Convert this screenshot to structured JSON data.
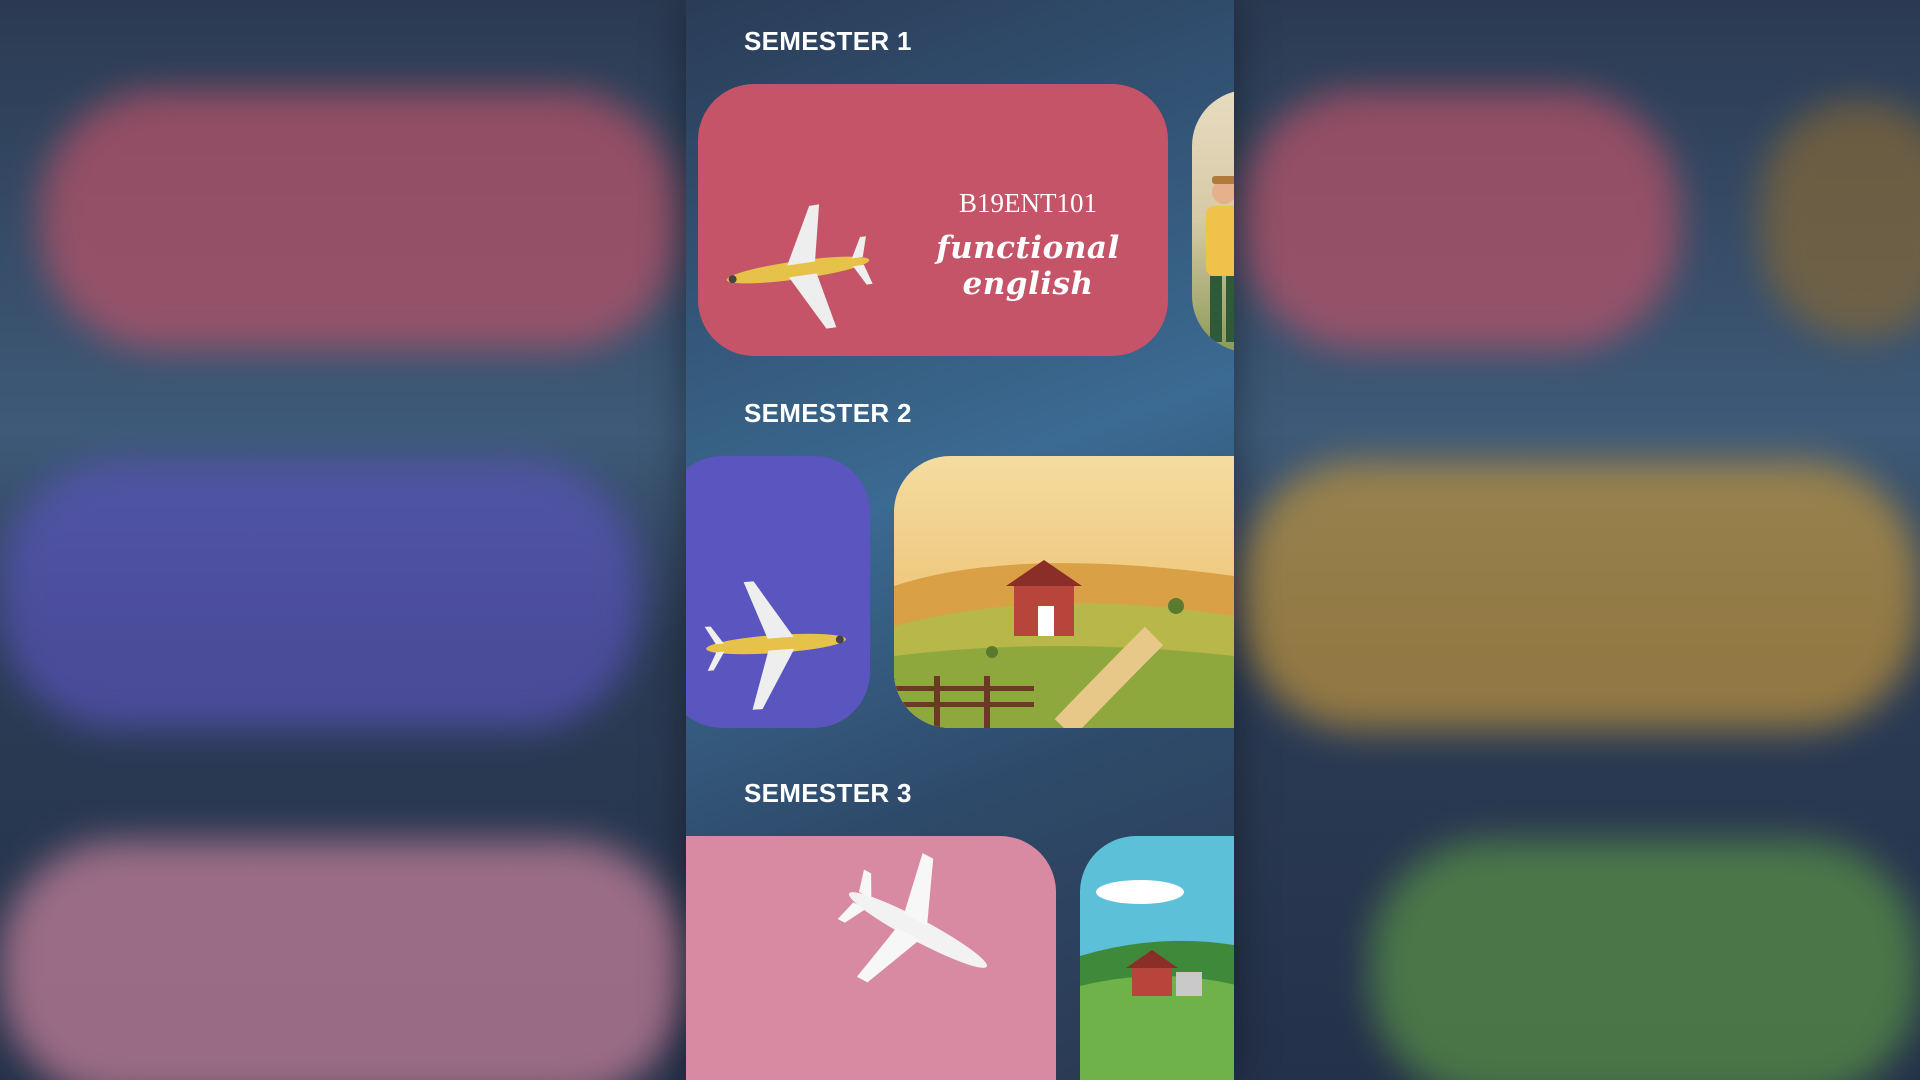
{
  "semesters": [
    {
      "title": "SEMESTER 1",
      "cards": [
        {
          "code": "B19ENT101",
          "name": "functional english",
          "color": "#c65468",
          "art": "airplane-gold"
        },
        {
          "art": "farmer-illustration"
        }
      ]
    },
    {
      "title": "SEMESTER 2",
      "cards": [
        {
          "color": "#5b55c0",
          "art": "airplane-gold"
        },
        {
          "art": "barn-farm-illustration"
        }
      ]
    },
    {
      "title": "SEMESTER 3",
      "cards": [
        {
          "color": "#d98aa3",
          "art": "airplane-white"
        },
        {
          "art": "barn-meadow-illustration"
        }
      ]
    }
  ]
}
